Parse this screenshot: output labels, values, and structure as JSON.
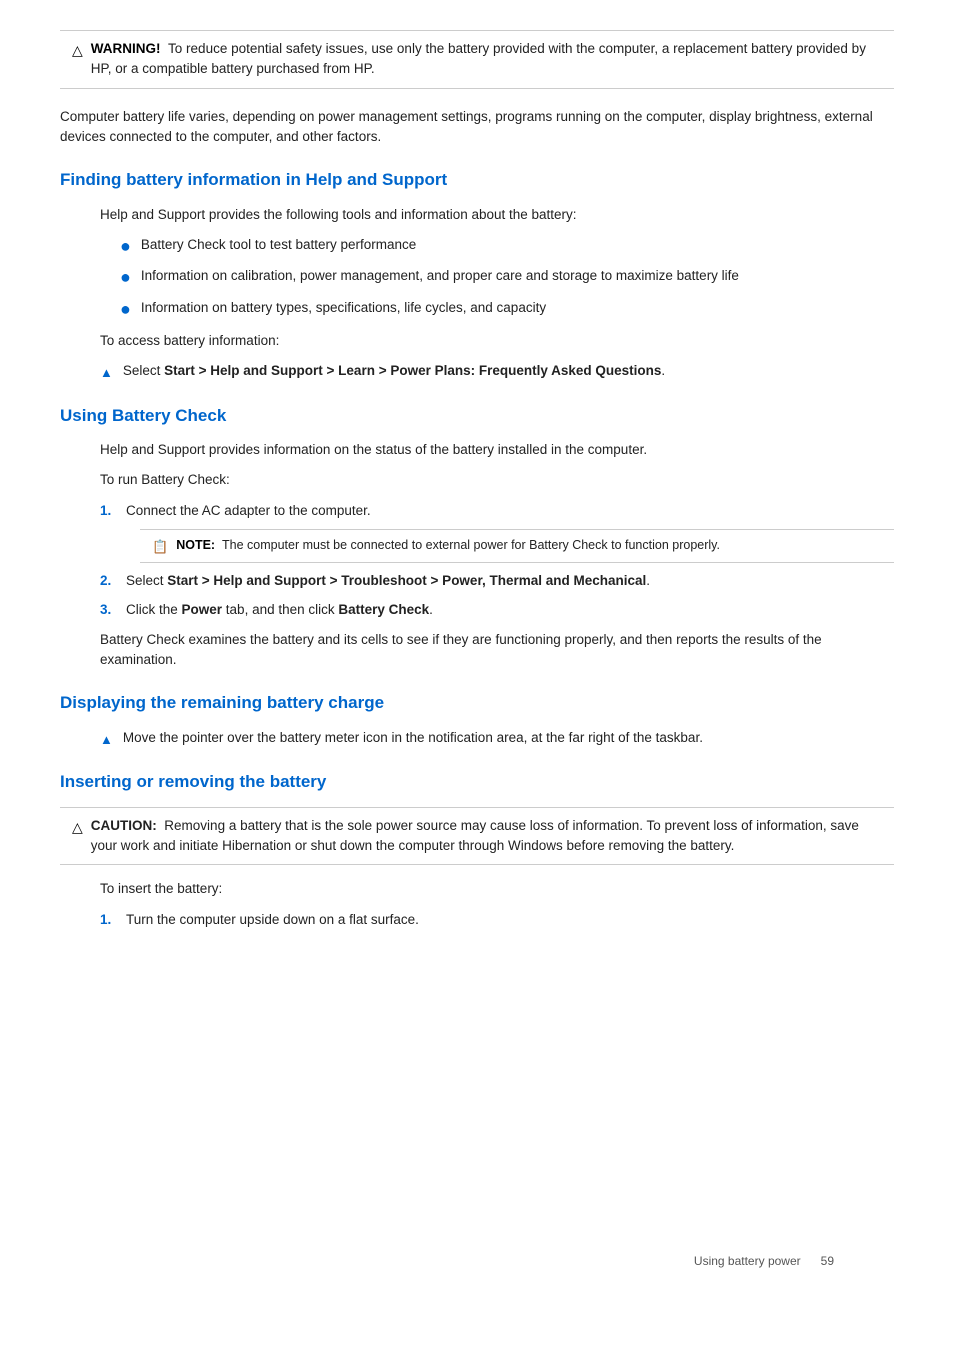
{
  "warning": {
    "label": "WARNING!",
    "text": "To reduce potential safety issues, use only the battery provided with the computer, a replacement battery provided by HP, or a compatible battery purchased from HP."
  },
  "intro_text": "Computer battery life varies, depending on power management settings, programs running on the computer, display brightness, external devices connected to the computer, and other factors.",
  "section1": {
    "heading": "Finding battery information in Help and Support",
    "intro": "Help and Support provides the following tools and information about the battery:",
    "bullets": [
      "Battery Check tool to test battery performance",
      "Information on calibration, power management, and proper care and storage to maximize battery life",
      "Information on battery types, specifications, life cycles, and capacity"
    ],
    "access_text": "To access battery information:",
    "arrow_text": "Select Start > Help and Support > Learn > Power Plans: Frequently Asked Questions."
  },
  "section2": {
    "heading": "Using Battery Check",
    "intro": "Help and Support provides information on the status of the battery installed in the computer.",
    "run_text": "To run Battery Check:",
    "steps": [
      "Connect the AC adapter to the computer.",
      "Select Start > Help and Support > Troubleshoot > Power, Thermal and Mechanical.",
      "Click the Power tab, and then click Battery Check."
    ],
    "note_label": "NOTE:",
    "note_text": "The computer must be connected to external power for Battery Check to function properly.",
    "step2_text_bold_parts": [
      "Start > Help and Support > Troubleshoot > Power, Thermal and Mechanical"
    ],
    "step3_text_bold_parts": [
      "Power",
      "Battery Check"
    ],
    "conclusion": "Battery Check examines the battery and its cells to see if they are functioning properly, and then reports the results of the examination."
  },
  "section3": {
    "heading": "Displaying the remaining battery charge",
    "arrow_text": "Move the pointer over the battery meter icon in the notification area, at the far right of the taskbar."
  },
  "section4": {
    "heading": "Inserting or removing the battery",
    "caution_label": "CAUTION:",
    "caution_text": "Removing a battery that is the sole power source may cause loss of information. To prevent loss of information, save your work and initiate Hibernation or shut down the computer through Windows before removing the battery.",
    "insert_text": "To insert the battery:",
    "steps": [
      "Turn the computer upside down on a flat surface."
    ]
  },
  "footer": {
    "text": "Using battery power",
    "page": "59"
  }
}
